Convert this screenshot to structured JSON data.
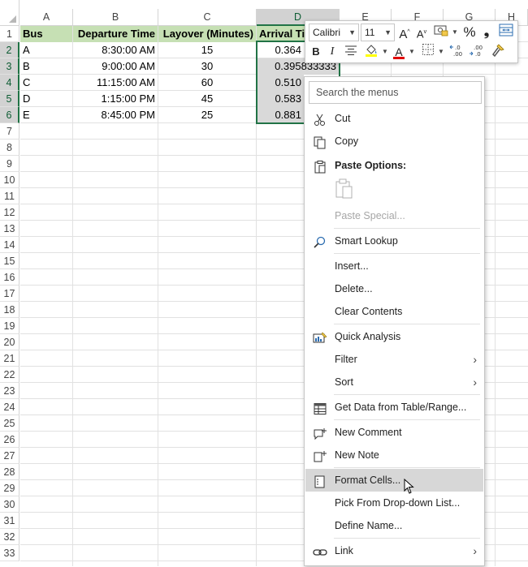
{
  "columns": [
    "A",
    "B",
    "C",
    "D",
    "E",
    "F",
    "G",
    "H"
  ],
  "rows": [
    "1",
    "2",
    "3",
    "4",
    "5",
    "6",
    "7",
    "8",
    "9",
    "10",
    "11",
    "12",
    "13",
    "14",
    "15",
    "16",
    "17",
    "18",
    "19",
    "20",
    "21",
    "22",
    "23",
    "24",
    "25",
    "26",
    "27",
    "28",
    "29",
    "30",
    "31",
    "32",
    "33"
  ],
  "table": {
    "headers": [
      "Bus",
      "Departure Time",
      "Layover (Minutes)",
      "Arrival Ti"
    ],
    "data": [
      [
        "A",
        "8:30:00 AM",
        "15",
        "0.364"
      ],
      [
        "B",
        "9:00:00 AM",
        "30",
        "0.395833333"
      ],
      [
        "C",
        "11:15:00 AM",
        "60",
        "0.510"
      ],
      [
        "D",
        "1:15:00 PM",
        "45",
        "0.583"
      ],
      [
        "E",
        "8:45:00 PM",
        "25",
        "0.881"
      ]
    ]
  },
  "toolbar": {
    "font_name": "Calibri",
    "font_size": "11",
    "bold_label": "B",
    "italic_label": "I",
    "increase_font_label": "A",
    "decrease_font_label": "A",
    "percent_label": "%",
    "comma_label": "❟",
    "font_color_label": "A"
  },
  "menu": {
    "search_placeholder": "Search the menus",
    "cut": "Cut",
    "copy": "Copy",
    "paste_options": "Paste Options:",
    "paste_special": "Paste Special...",
    "smart_lookup": "Smart Lookup",
    "insert": "Insert...",
    "delete": "Delete...",
    "clear_contents": "Clear Contents",
    "quick_analysis": "Quick Analysis",
    "filter": "Filter",
    "sort": "Sort",
    "get_data": "Get Data from Table/Range...",
    "new_comment": "New Comment",
    "new_note": "New Note",
    "format_cells": "Format Cells...",
    "pick_dropdown": "Pick From Drop-down List...",
    "define_name": "Define Name...",
    "link": "Link",
    "submenu_arrow": "›"
  },
  "colors": {
    "header_fill": "#c6e0b4",
    "selection_border": "#217346",
    "selected_fill": "#d9d9d9",
    "font_color_bar": "#e00000",
    "fill_color_bar": "#ffff00"
  }
}
